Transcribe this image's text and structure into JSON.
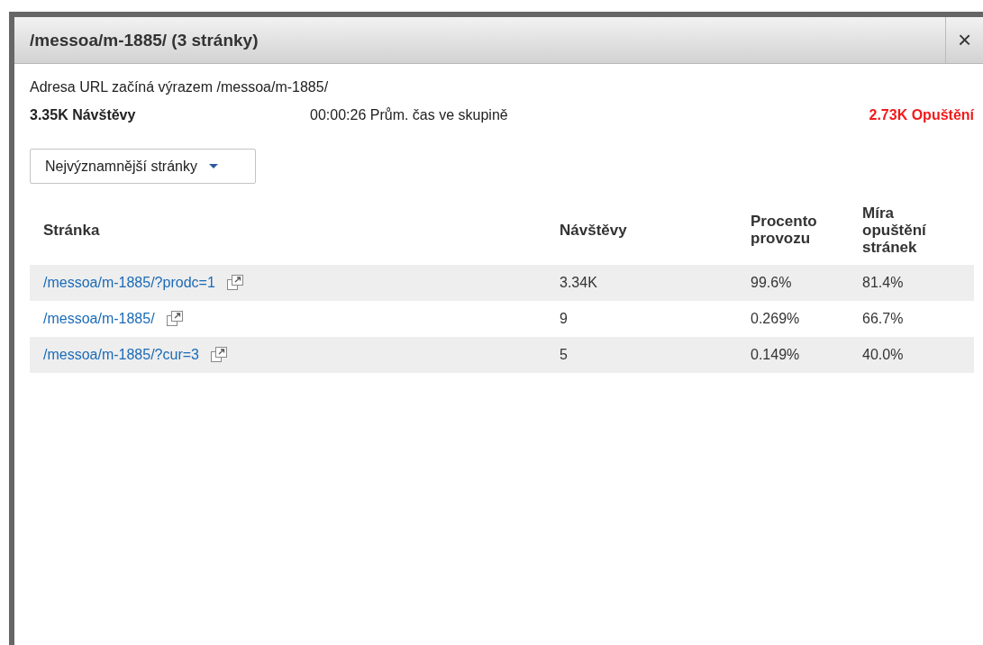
{
  "dialog": {
    "title": "/messoa/m-1885/ (3 stránky)",
    "close": "×"
  },
  "description": "Adresa URL začíná výrazem /messoa/m-1885/",
  "summary": {
    "visits": "3.35K Návštěvy",
    "avg_time": "00:00:26 Prům. čas ve skupině",
    "exits": "2.73K Opuštění"
  },
  "dropdown": {
    "value": "Nejvýznamnější stránky"
  },
  "table": {
    "columns": [
      "Stránka",
      "Návštěvy",
      "Procento provozu",
      "Míra opuštění stránek"
    ],
    "rows": [
      {
        "page": "/messoa/m-1885/?prodc=1",
        "visits": "3.34K",
        "traffic": "99.6%",
        "exit_rate": "81.4%"
      },
      {
        "page": "/messoa/m-1885/",
        "visits": "9",
        "traffic": "0.269%",
        "exit_rate": "66.7%"
      },
      {
        "page": "/messoa/m-1885/?cur=3",
        "visits": "5",
        "traffic": "0.149%",
        "exit_rate": "40.0%"
      }
    ]
  }
}
